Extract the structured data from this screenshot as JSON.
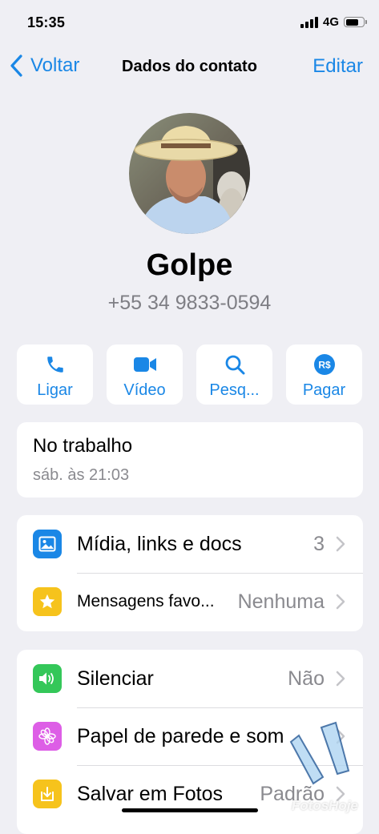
{
  "status_bar": {
    "time": "15:35",
    "network": "4G",
    "battery_level": 0.75
  },
  "nav": {
    "back_label": "Voltar",
    "title": "Dados do contato",
    "edit_label": "Editar"
  },
  "contact": {
    "name": "Golpe",
    "phone": "+55 34 9833-0594"
  },
  "actions": [
    {
      "label": "Ligar",
      "icon": "phone-icon"
    },
    {
      "label": "Vídeo",
      "icon": "video-icon"
    },
    {
      "label": "Pesq...",
      "icon": "search-icon"
    },
    {
      "label": "Pagar",
      "icon": "payment-icon"
    }
  ],
  "pay_icon_text": "R$",
  "about": {
    "status": "No trabalho",
    "time": "sáb. às 21:03"
  },
  "media_section": {
    "rows": [
      {
        "label": "Mídia, links e docs",
        "value": "3",
        "icon": "photo-icon",
        "color": "#1a87e6"
      },
      {
        "label": "Mensagens favo...",
        "value": "Nenhuma",
        "icon": "star-icon",
        "color": "#f6c31c"
      }
    ]
  },
  "settings_section": {
    "rows": [
      {
        "label": "Silenciar",
        "value": "Não",
        "icon": "speaker-icon",
        "color": "#34c759"
      },
      {
        "label": "Papel de parede e som",
        "value": "",
        "icon": "flower-icon",
        "color": "#dd5ee6"
      },
      {
        "label": "Salvar em Fotos",
        "value": "Padrão",
        "icon": "download-icon",
        "color": "#f6c31c"
      }
    ]
  },
  "watermark": {
    "text": "FotosHoje"
  },
  "colors": {
    "accent": "#1a87e6",
    "background": "#efeff4",
    "secondary_text": "#8a8a8f"
  }
}
